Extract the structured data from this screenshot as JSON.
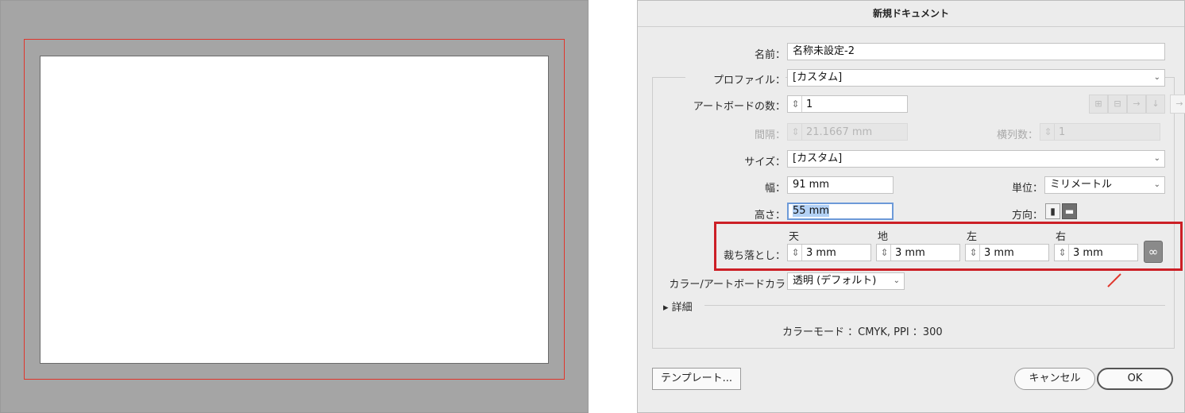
{
  "dialog": {
    "title": "新規ドキュメント",
    "name_label": "名前：",
    "name_value": "名称未設定-2",
    "profile_label": "プロファイル：",
    "profile_value": "[カスタム]",
    "artboards_label": "アートボードの数：",
    "artboards_value": "1",
    "spacing_label": "間隔：",
    "spacing_value": "21.1667 mm",
    "columns_label": "横列数：",
    "columns_value": "1",
    "size_label": "サイズ：",
    "size_value": "[カスタム]",
    "width_label": "幅：",
    "width_value": "91 mm",
    "units_label": "単位：",
    "units_value": "ミリメートル",
    "height_label": "高さ：",
    "height_value": "55 mm",
    "orientation_label": "方向：",
    "bleed_label": "裁ち落とし：",
    "bleed": {
      "top_label": "天",
      "top_value": "3 mm",
      "bottom_label": "地",
      "bottom_value": "3 mm",
      "left_label": "左",
      "left_value": "3 mm",
      "right_label": "右",
      "right_value": "3 mm"
    },
    "color_label": "カラー/アートボードカラ",
    "color_value": "透明 (デフォルト)",
    "advanced_label": "詳細",
    "color_mode": "カラーモード ：CMYK, PPI ：300",
    "template_button": "テンプレート...",
    "cancel_button": "キャンセル",
    "ok_button": "OK"
  },
  "colors": {
    "bleed_guide": "#e0362c",
    "highlight": "#cc1f26",
    "pasteboard": "#a5a5a5"
  }
}
